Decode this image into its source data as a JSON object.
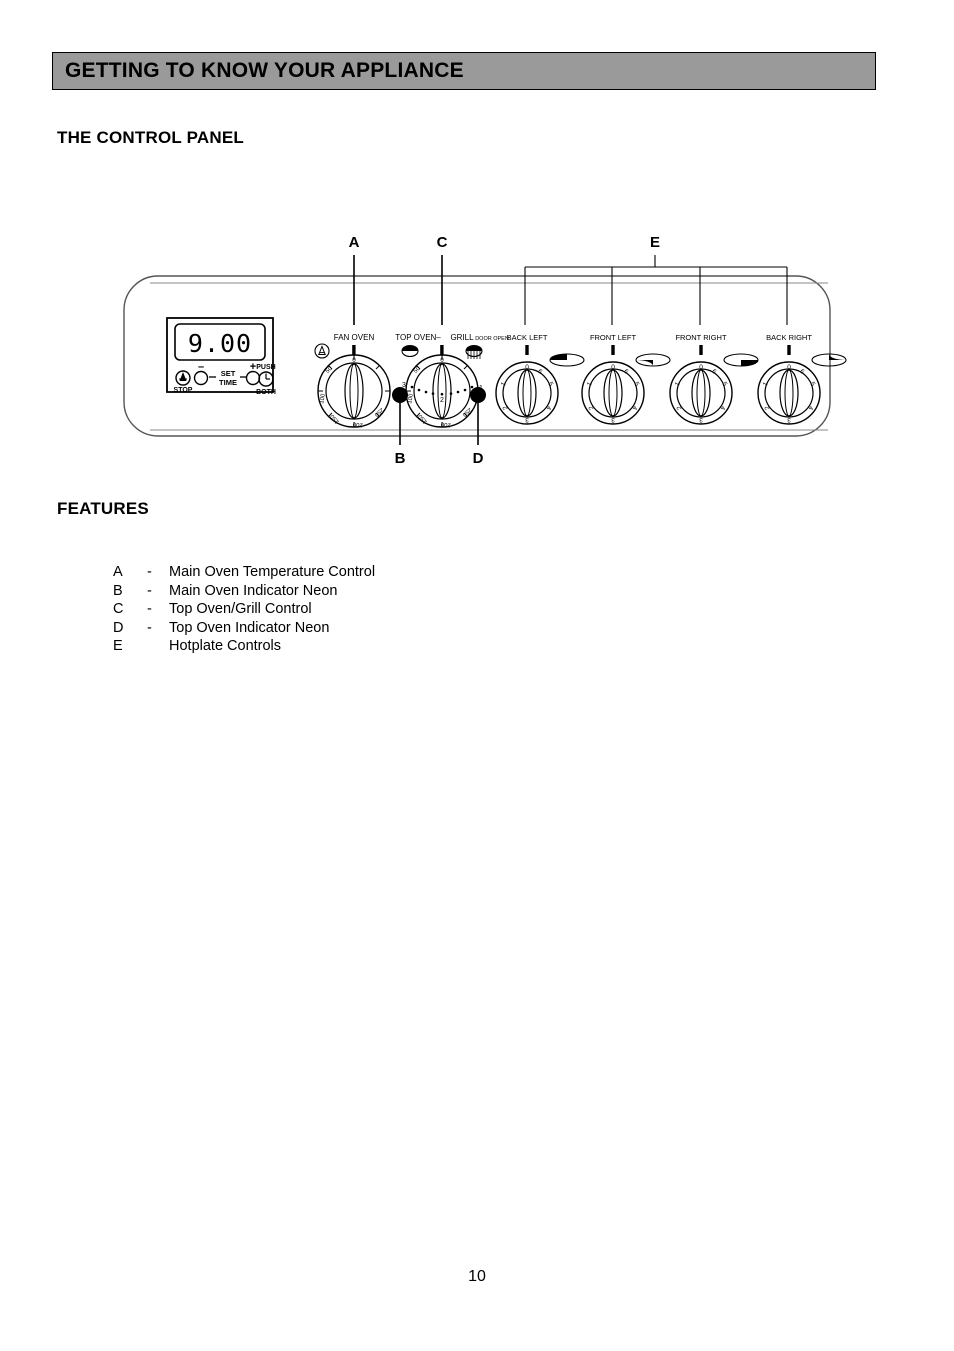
{
  "header": {
    "title": "GETTING TO KNOW YOUR APPLIANCE"
  },
  "headings": {
    "control_panel": "THE CONTROL PANEL",
    "features": "FEATURES"
  },
  "diagram": {
    "callouts": {
      "a": "A",
      "b": "B",
      "c": "C",
      "d": "D",
      "e": "E"
    },
    "timer": {
      "display_value": "9.00",
      "stop_label": "STOP",
      "minus_label": "–",
      "plus_label": "+",
      "set_label": "SET",
      "time_label": "TIME",
      "push_label": "PUSH",
      "both_label": "BOTH"
    },
    "knobs": [
      {
        "id": "fan-oven",
        "label": "FAN OVEN",
        "scale": [
          "0",
          "50",
          "100",
          "150",
          "200",
          "250"
        ]
      },
      {
        "id": "top-oven-grill",
        "label_left": "TOP OVEN–",
        "label_right": "GRILL",
        "label_note": "DOOR OPEN",
        "scale": [
          "0",
          "50",
          "100",
          "150",
          "200",
          "250"
        ],
        "grill_marks": [
          "1",
          "2",
          "3"
        ]
      },
      {
        "id": "back-left",
        "label": "BACK LEFT",
        "scale": [
          "0",
          "1",
          "2",
          "3",
          "4",
          "5",
          "6"
        ]
      },
      {
        "id": "front-left",
        "label": "FRONT LEFT",
        "scale": [
          "0",
          "1",
          "2",
          "3",
          "4",
          "5",
          "6"
        ]
      },
      {
        "id": "front-right",
        "label": "FRONT RIGHT",
        "scale": [
          "0",
          "1",
          "2",
          "3",
          "4",
          "5",
          "6"
        ]
      },
      {
        "id": "back-right",
        "label": "BACK RIGHT",
        "scale": [
          "0",
          "1",
          "2",
          "3",
          "4",
          "5",
          "6"
        ]
      }
    ]
  },
  "features": [
    {
      "key": "A",
      "dash": "-",
      "desc": "Main Oven Temperature Control"
    },
    {
      "key": "B",
      "dash": "-",
      "desc": "Main Oven Indicator Neon"
    },
    {
      "key": "C",
      "dash": "-",
      "desc": "Top Oven/Grill Control"
    },
    {
      "key": "D",
      "dash": "-",
      "desc": "Top Oven Indicator Neon"
    },
    {
      "key": "E",
      "dash": "",
      "desc": "Hotplate Controls"
    }
  ],
  "footer": {
    "page_number": "10"
  },
  "colors": {
    "banner_background": "#9a9a9a",
    "text": "#000000",
    "page_background": "#ffffff"
  }
}
